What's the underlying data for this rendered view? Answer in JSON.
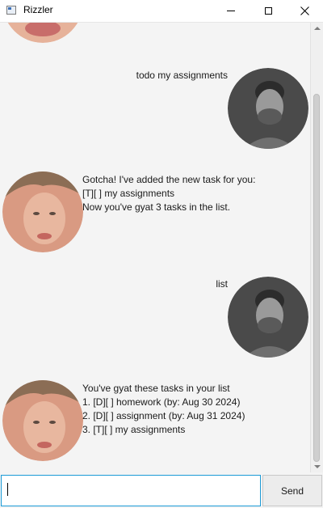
{
  "window": {
    "title": "Rizzler"
  },
  "conversation": [
    {
      "sender": "user",
      "text": "todo my assignments"
    },
    {
      "sender": "bot",
      "text": "Gotcha! I've added the new task for you:\n[T][ ] my assignments\nNow you've gyat 3 tasks in the list."
    },
    {
      "sender": "user",
      "text": "list"
    },
    {
      "sender": "bot",
      "text": "You've gyat these tasks in your list\n1. [D][ ] homework (by: Aug 30 2024)\n2. [D][ ] assignment (by: Aug 31 2024)\n3. [T][ ] my assignments"
    }
  ],
  "input": {
    "value": ""
  },
  "send_button": {
    "label": "Send"
  },
  "colors": {
    "background": "#f4f4f4",
    "input_focus_border": "#1b9ad6",
    "user_avatar_tone": "#4a4a4a",
    "bot_avatar_tone": "#e8b79f"
  }
}
